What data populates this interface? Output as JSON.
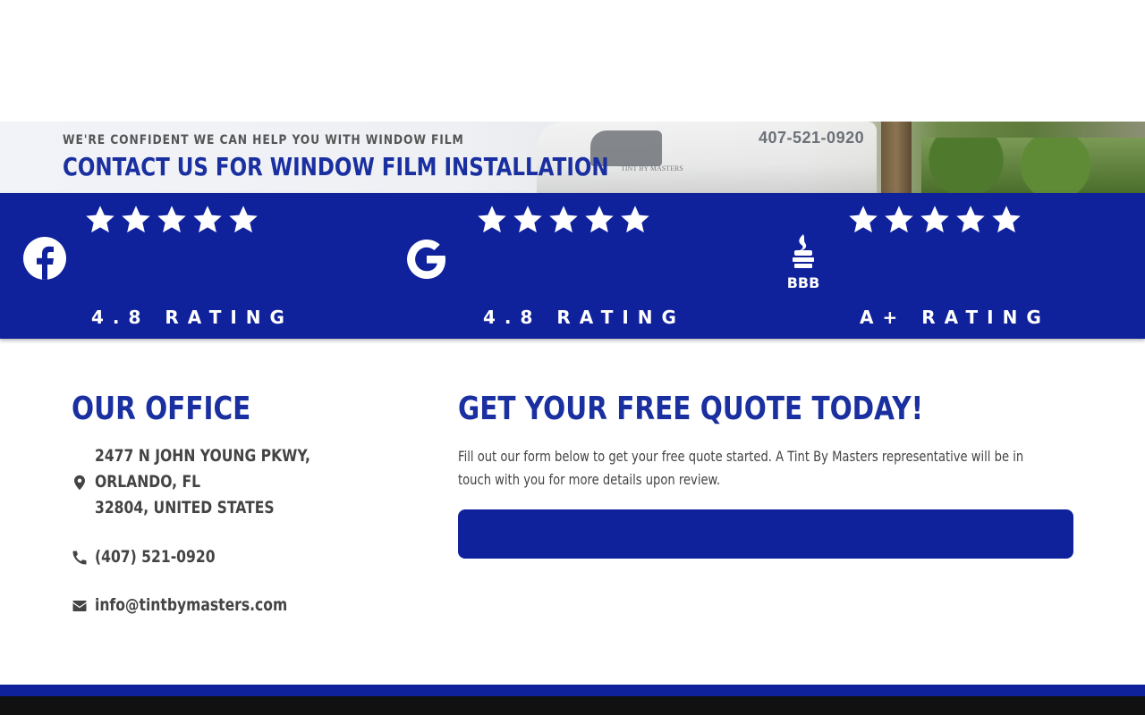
{
  "hero": {
    "subtitle": "WE'RE CONFIDENT WE CAN HELP YOU WITH WINDOW FILM",
    "title": "CONTACT US FOR WINDOW FILM INSTALLATION",
    "truck_phone": "407-521-0920",
    "truck_brand": "TINT BY MASTERS"
  },
  "ratings": [
    {
      "platform": "facebook",
      "icon": "facebook-icon",
      "stars": 5,
      "label": "4.8 RATING"
    },
    {
      "platform": "google",
      "icon": "google-icon",
      "stars": 5,
      "label": "4.8 RATING"
    },
    {
      "platform": "bbb",
      "icon": "bbb-icon",
      "stars": 5,
      "label": "A+ RATING"
    }
  ],
  "office": {
    "title": "OUR OFFICE",
    "address_line1": "2477 N JOHN YOUNG PKWY,",
    "address_line2": "ORLANDO, FL",
    "address_line3": "32804, UNITED STATES",
    "phone": "(407) 521-0920",
    "email": "info@tintbymasters.com"
  },
  "quote": {
    "title": "GET YOUR FREE QUOTE TODAY!",
    "description": "Fill out our form below to get your free quote started. A Tint By Masters representative will be in touch with you for more details upon review."
  },
  "colors": {
    "brand_blue": "#0f219b",
    "heading_blue": "#1a2fa0",
    "footer_dark": "#111111"
  }
}
